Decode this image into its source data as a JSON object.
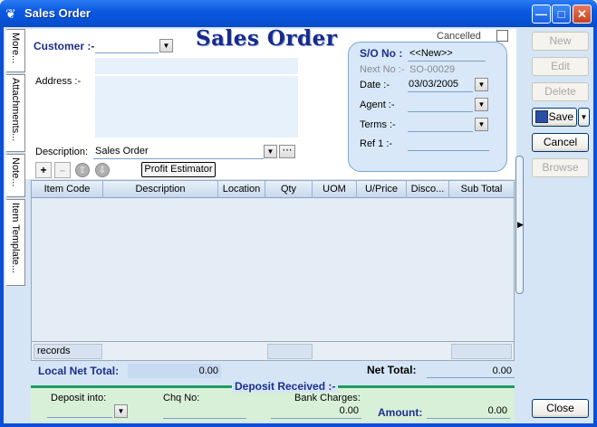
{
  "window": {
    "title": "Sales Order",
    "title_icon": "tree-icon"
  },
  "tabs": [
    "More...",
    "Attachments...",
    "Note...",
    "Item Template..."
  ],
  "form": {
    "heading": "Sales Order",
    "customer_label": "Customer :-",
    "customer_value": "",
    "address_label": "Address :-",
    "description_label": "Description:",
    "description_value": "Sales Order",
    "cancelled_label": "Cancelled",
    "cancelled_checked": false
  },
  "so": {
    "so_label": "S/O No :",
    "so_value": "<<New>>",
    "next_label": "Next No :-",
    "next_value": "SO-00029",
    "date_label": "Date :-",
    "date_value": "03/03/2005",
    "agent_label": "Agent :-",
    "agent_value": "",
    "terms_label": "Terms :-",
    "terms_value": "",
    "ref_label": "Ref 1 :-",
    "ref_value": ""
  },
  "toolbar": {
    "profit_estimator_label": "Profit Estimator"
  },
  "grid": {
    "columns": [
      "Item Code",
      "Description",
      "Location",
      "Qty",
      "UOM",
      "U/Price",
      "Disco...",
      "Sub Total"
    ],
    "rows": [],
    "footer_label": "records"
  },
  "totals": {
    "local_net_label": "Local Net Total:",
    "local_net_value": "0.00",
    "net_label": "Net Total:",
    "net_value": "0.00"
  },
  "deposit": {
    "title": "Deposit Received :-",
    "deposit_into_label": "Deposit into:",
    "deposit_into_value": "",
    "chq_label": "Chq No:",
    "chq_value": "",
    "bank_charges_label": "Bank Charges:",
    "bank_charges_value": "0.00",
    "amount_label": "Amount:",
    "amount_value": "0.00"
  },
  "buttons": {
    "new": "New",
    "edit": "Edit",
    "delete": "Delete",
    "save": "Save",
    "cancel": "Cancel",
    "browse": "Browse",
    "close": "Close"
  }
}
